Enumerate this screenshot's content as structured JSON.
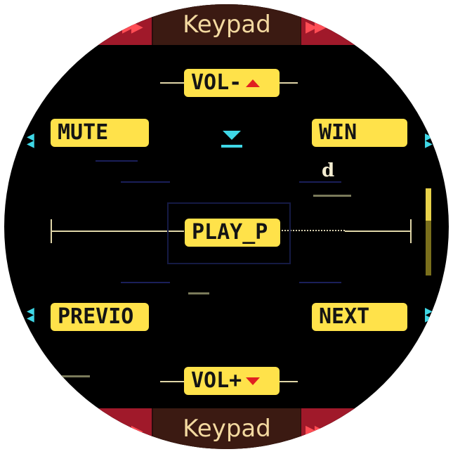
{
  "header": {
    "title": "Keypad"
  },
  "footer": {
    "title": "Keypad"
  },
  "keys": {
    "vol_up": "VOL-",
    "vol_down": "VOL+",
    "mute": "MUTE",
    "win": "WIN",
    "play": "PLAY_P",
    "previous": "PREVIO",
    "next": "NEXT"
  },
  "labels": {
    "letter_d": "d"
  },
  "colors": {
    "key_bg": "#ffe24a",
    "accent_red": "#e02020",
    "cyan": "#3fd7e6",
    "band_red": "#a0192a",
    "title_text": "#f3d9a0"
  }
}
